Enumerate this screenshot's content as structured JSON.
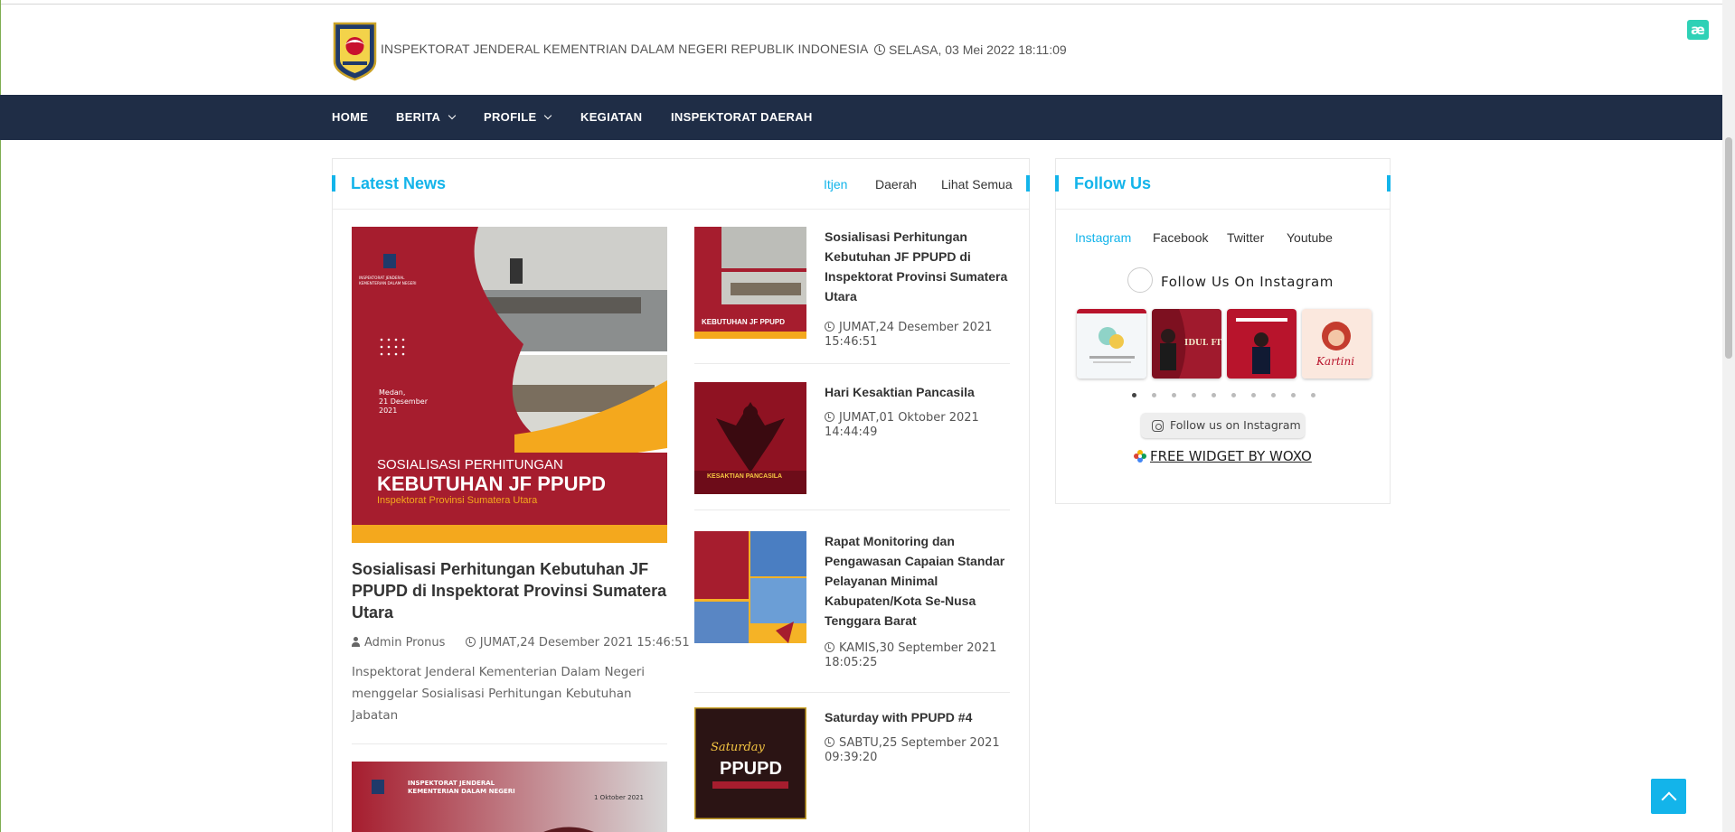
{
  "header": {
    "site_title": "INSPEKTORAT JENDERAL KEMENTRIAN DALAM NEGERI REPUBLIK INDONESIA",
    "clock_text": "SELASA, 03 Mei 2022 18:11:09",
    "corner_badge": "æ"
  },
  "nav": {
    "items": [
      "HOME",
      "BERITA",
      "PROFILE",
      "KEGIATAN",
      "INSPEKTORAT DAERAH"
    ]
  },
  "latest_news": {
    "title": "Latest News",
    "tabs": [
      "Itjen",
      "Daerah",
      "Lihat Semua"
    ],
    "active_tab": "Itjen",
    "featured": {
      "title": "Sosialisasi Perhitungan Kebutuhan JF PPUPD di Inspektorat Provinsi Sumatera Utara",
      "author": "Admin Pronus",
      "date": "JUMAT,24 Desember 2021 15:46:51",
      "excerpt": "Inspektorat Jenderal Kementerian Dalam Negeri menggelar Sosialisasi Perhitungan Kebutuhan Jabatan",
      "image": {
        "org_line1": "INSPEKTORAT JENDERAL",
        "org_line2": "KEMENTERIAN DALAM NEGERI",
        "place": "Medan,",
        "date": "21 Desember",
        "year": "2021",
        "banner_small": "SOSIALISASI PERHITUNGAN",
        "banner_big": "KEBUTUHAN JF PPUPD",
        "banner_sub": "Inspektorat Provinsi Sumatera Utara"
      }
    },
    "second_image": {
      "org_line1": "INSPEKTORAT JENDERAL",
      "org_line2": "KEMENTERIAN DALAM NEGERI",
      "date": "1 Oktober 2021"
    },
    "side_items": [
      {
        "title": "Sosialisasi Perhitungan Kebutuhan JF PPUPD di Inspektorat Provinsi Sumatera Utara",
        "date": "JUMAT,24 Desember 2021 15:46:51",
        "thumb_text": "KEBUTUHAN JF PPUPD"
      },
      {
        "title": "Hari Kesaktian Pancasila",
        "date": "JUMAT,01 Oktober 2021 14:44:49",
        "thumb_text": "KESAKTIAN PANCASILA"
      },
      {
        "title": "Rapat Monitoring dan Pengawasan Capaian Standar Pelayanan Minimal Kabupaten/Kota Se-Nusa Tenggara Barat",
        "date": "KAMIS,30 September 2021 18:05:25",
        "thumb_text": ""
      },
      {
        "title": "Saturday with PPUPD #4",
        "date": "SABTU,25 September 2021 09:39:20",
        "thumb_text": "PPUPD"
      }
    ]
  },
  "follow_us": {
    "title": "Follow Us",
    "tabs": [
      "Instagram",
      "Facebook",
      "Twitter",
      "Youtube"
    ],
    "active_tab": "Instagram",
    "heading": "Follow Us On Instagram",
    "tiles": [
      {
        "label": "",
        "bg": "#f4f7f9"
      },
      {
        "label": "IDUL FITRI",
        "bg": "#7d1020"
      },
      {
        "label": "",
        "bg": "#b8142c"
      },
      {
        "label": "Kartini",
        "bg": "#fbe8de"
      }
    ],
    "dots_count": 10,
    "active_dot": 0,
    "button_label": "Follow us on Instagram",
    "widget_label": "FREE WIDGET BY WOXO"
  },
  "colors": {
    "accent": "#13b4ea",
    "navbar": "#1f2d46",
    "brand_red": "#a51c2c"
  }
}
